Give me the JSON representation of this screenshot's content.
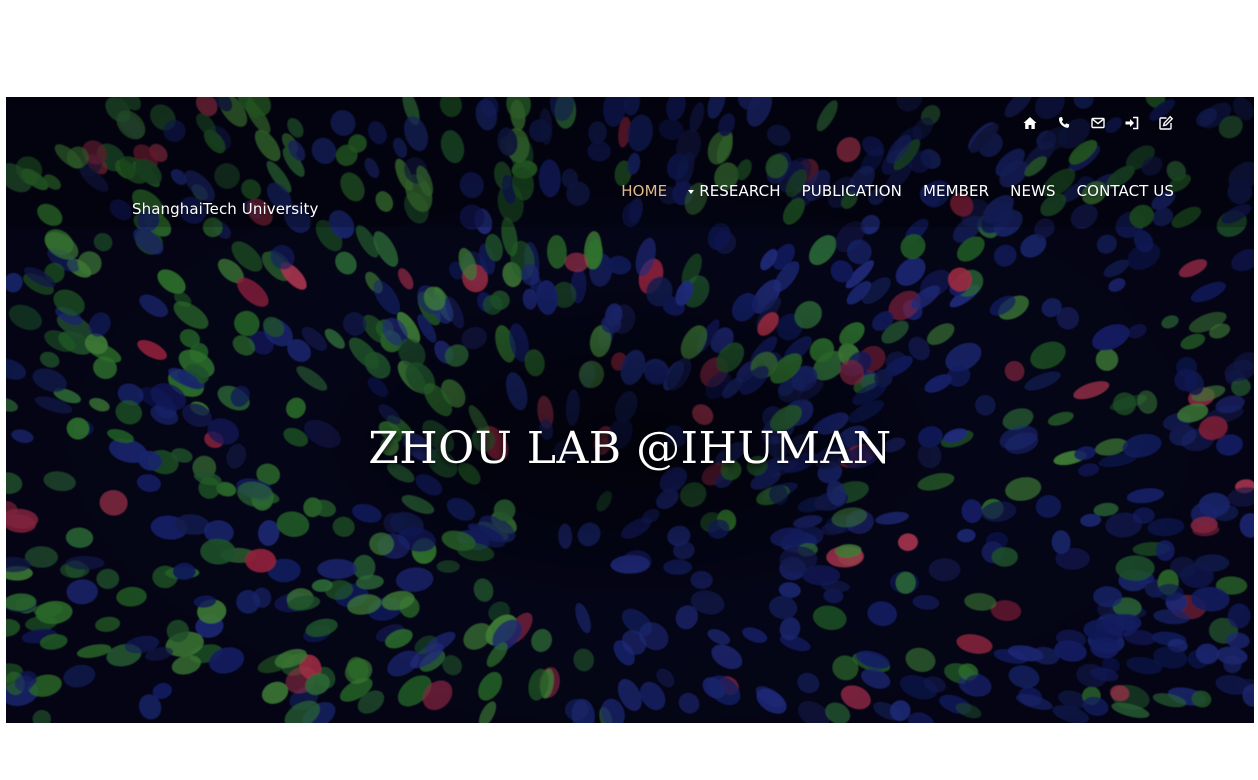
{
  "brand": {
    "name": "ShanghaiTech University"
  },
  "top_icons": [
    {
      "name": "home-icon"
    },
    {
      "name": "phone-icon"
    },
    {
      "name": "envelope-icon"
    },
    {
      "name": "sign-in-icon"
    },
    {
      "name": "edit-icon"
    }
  ],
  "nav": {
    "items": [
      {
        "label": "HOME",
        "active": true
      },
      {
        "label": "RESEARCH",
        "has_dropdown": true
      },
      {
        "label": "PUBLICATION"
      },
      {
        "label": "MEMBER"
      },
      {
        "label": "NEWS"
      },
      {
        "label": "CONTACT US"
      }
    ]
  },
  "hero": {
    "title": "ZHOU LAB @IHUMAN"
  },
  "colors": {
    "active_nav": "#e0b98c",
    "text": "#ffffff",
    "background": "#05061a",
    "cell_green": "#3f9a3c",
    "cell_blue": "#1c2a8a",
    "cell_red": "#d43b5a"
  }
}
